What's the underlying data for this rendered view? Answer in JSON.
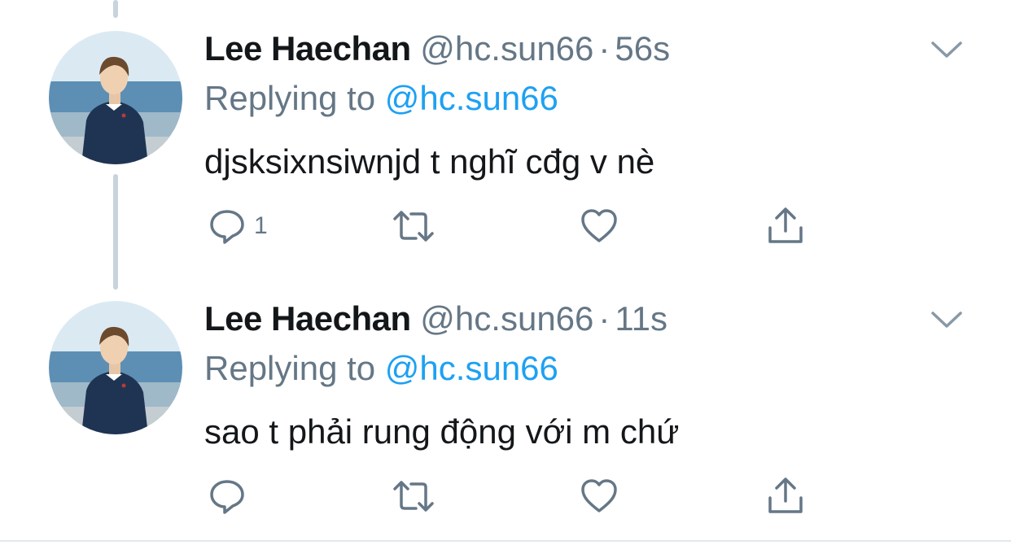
{
  "tweets": [
    {
      "name": "Lee Haechan",
      "handle": "@hc.sun66",
      "separator": "·",
      "time": "56s",
      "reply_prefix": "Replying to ",
      "reply_to": "@hc.sun66",
      "text": "djsksixnsiwnjd t nghĩ cđg v nè",
      "reply_count": "1",
      "retweet_count": "",
      "like_count": ""
    },
    {
      "name": "Lee Haechan",
      "handle": "@hc.sun66",
      "separator": "·",
      "time": "11s",
      "reply_prefix": "Replying to ",
      "reply_to": "@hc.sun66",
      "text": "sao t phải rung động với m chứ",
      "reply_count": "",
      "retweet_count": "",
      "like_count": ""
    }
  ],
  "icons": {
    "reply": "reply-icon",
    "retweet": "retweet-icon",
    "like": "heart-icon",
    "share": "share-icon",
    "menu": "chevron-down-icon"
  },
  "colors": {
    "name": "#14171a",
    "secondary": "#657786",
    "link": "#1da1f2",
    "thread_line": "#c9d3dd"
  }
}
